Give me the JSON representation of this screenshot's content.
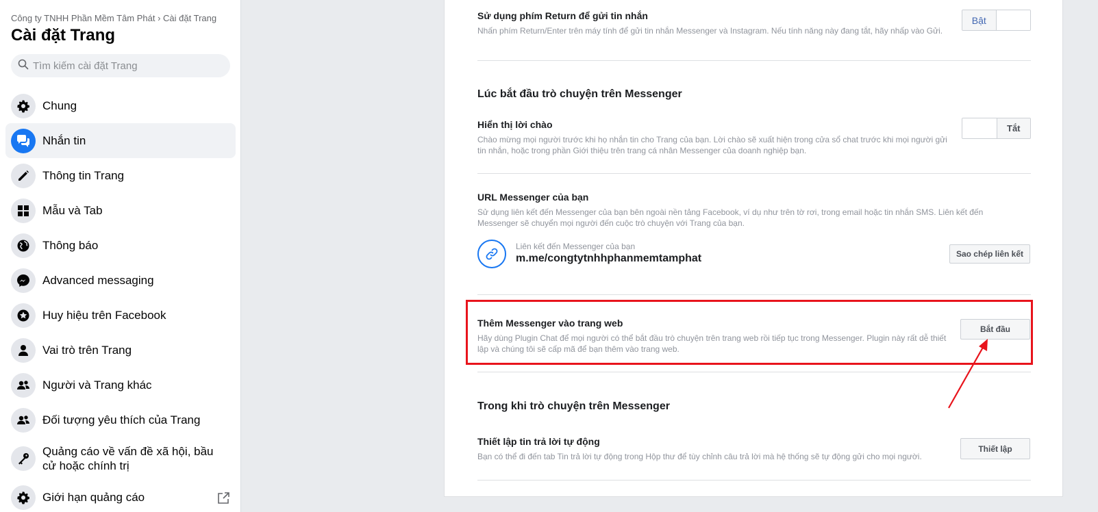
{
  "sidebar": {
    "breadcrumb": "Công ty TNHH Phần Mềm Tâm Phát › Cài đặt Trang",
    "title": "Cài đặt Trang",
    "search_placeholder": "Tìm kiếm cài đặt Trang",
    "items": [
      {
        "label": "Chung",
        "icon": "gear-icon"
      },
      {
        "label": "Nhắn tin",
        "icon": "messages-icon",
        "active": true
      },
      {
        "label": "Thông tin Trang",
        "icon": "pencil-icon"
      },
      {
        "label": "Mẫu và Tab",
        "icon": "grid-icon"
      },
      {
        "label": "Thông báo",
        "icon": "globe-icon"
      },
      {
        "label": "Advanced messaging",
        "icon": "messenger-icon"
      },
      {
        "label": "Huy hiệu trên Facebook",
        "icon": "star-badge-icon"
      },
      {
        "label": "Vai trò trên Trang",
        "icon": "person-icon"
      },
      {
        "label": "Người và Trang khác",
        "icon": "people-icon"
      },
      {
        "label": "Đối tượng yêu thích của Trang",
        "icon": "people-icon"
      },
      {
        "label": "Quảng cáo về vấn đề xã hội, bầu cử hoặc chính trị",
        "icon": "key-icon"
      },
      {
        "label": "Giới hạn quảng cáo",
        "icon": "gear-icon"
      }
    ]
  },
  "main": {
    "return_key": {
      "title": "Sử dụng phím Return để gửi tin nhắn",
      "desc": "Nhấn phím Return/Enter trên máy tính để gửi tin nhắn Messenger và Instagram. Nếu tính năng này đang tắt, hãy nhấp vào Gửi.",
      "toggle_label": "Bật"
    },
    "start_section": {
      "heading": "Lúc bắt đầu trò chuyện trên Messenger",
      "greeting": {
        "title": "Hiển thị lời chào",
        "desc": "Chào mừng mọi người trước khi họ nhắn tin cho Trang của bạn. Lời chào sẽ xuất hiện trong cửa sổ chat trước khi mọi người gửi tin nhắn, hoặc trong phần Giới thiệu trên trang cá nhân Messenger của doanh nghiệp bạn.",
        "toggle_label": "Tắt"
      },
      "url": {
        "title": "URL Messenger của bạn",
        "desc": "Sử dụng liên kết đến Messenger của bạn bên ngoài nền tảng Facebook, ví dụ như trên tờ rơi, trong email hoặc tin nhắn SMS. Liên kết đến Messenger sẽ chuyển mọi người đến cuộc trò chuyện với Trang của bạn.",
        "link_caption": "Liên kết đến Messenger của bạn",
        "link_value": "m.me/congtytnhhphanmemtamphat",
        "copy_button": "Sao chép liên kết"
      },
      "website": {
        "title": "Thêm Messenger vào trang web",
        "desc": "Hãy dùng Plugin Chat để mọi người có thể bắt đầu trò chuyện trên trang web rồi tiếp tục trong Messenger. Plugin này rất dễ thiết lập và chúng tôi sẽ cấp mã để bạn thêm vào trang web.",
        "button": "Bắt đầu"
      }
    },
    "during_section": {
      "heading": "Trong khi trò chuyện trên Messenger",
      "auto_reply": {
        "title": "Thiết lập tin trả lời tự động",
        "desc": "Bạn có thể đi đến tab Tin trả lời tự động trong Hộp thư để tùy chỉnh câu trả lời mà hệ thống sẽ tự động gửi cho mọi người.",
        "button": "Thiết lập"
      }
    }
  },
  "colors": {
    "accent": "#1877f2",
    "highlight": "#e8141c"
  }
}
